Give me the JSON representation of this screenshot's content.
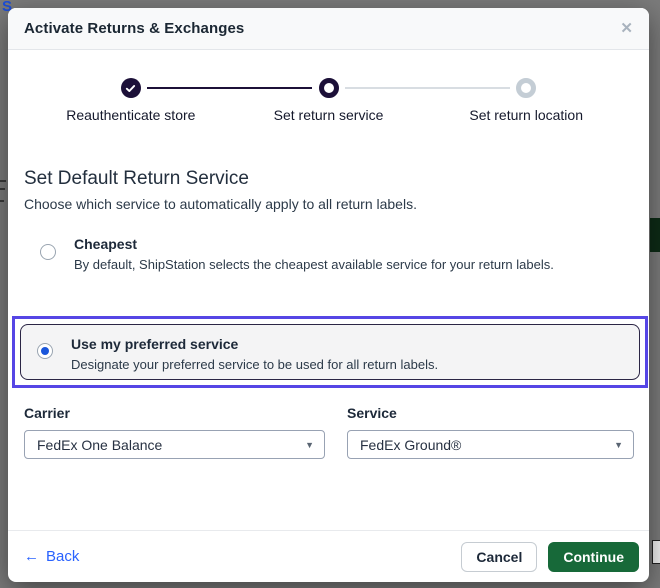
{
  "background": {
    "partial_text": "S"
  },
  "modal": {
    "title": "Activate Returns & Exchanges",
    "close_glyph": "✕"
  },
  "stepper": {
    "steps": [
      {
        "label": "Reauthenticate store",
        "state": "completed"
      },
      {
        "label": "Set return service",
        "state": "current"
      },
      {
        "label": "Set return location",
        "state": "upcoming"
      }
    ]
  },
  "section": {
    "title": "Set Default Return Service",
    "subtitle": "Choose which service to automatically apply to all return labels."
  },
  "options": [
    {
      "label": "Cheapest",
      "description": "By default, ShipStation selects the cheapest available service for your return labels.",
      "selected": false
    },
    {
      "label": "Use my preferred service",
      "description": "Designate your preferred service to be used for all return labels.",
      "selected": true,
      "highlighted": true
    }
  ],
  "form": {
    "carrier": {
      "label": "Carrier",
      "value": "FedEx One Balance"
    },
    "service": {
      "label": "Service",
      "value": "FedEx Ground®"
    },
    "caret_glyph": "▼"
  },
  "footer": {
    "back_arrow": "←",
    "back_label": "Back",
    "cancel_label": "Cancel",
    "continue_label": "Continue"
  },
  "colors": {
    "highlight_purple": "#5646e5",
    "stepper_dark": "#1c1038",
    "radio_selected_blue": "#1a56db",
    "continue_green": "#176939",
    "link_blue": "#2962ff",
    "overlay_gray": "#7b7b7b"
  }
}
